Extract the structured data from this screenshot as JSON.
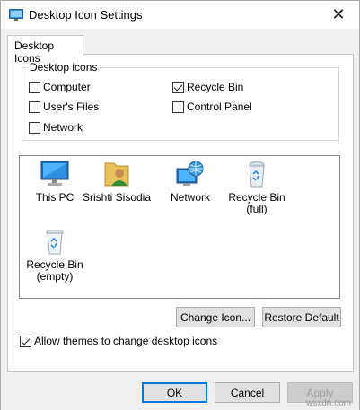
{
  "window": {
    "title": "Desktop Icon Settings",
    "close_glyph": "✕"
  },
  "tabs": [
    {
      "label": "Desktop Icons",
      "selected": true
    }
  ],
  "desktop_icons_group": {
    "title": "Desktop icons",
    "checkboxes": [
      {
        "label": "Computer",
        "checked": false
      },
      {
        "label": "Recycle Bin",
        "checked": true
      },
      {
        "label": "User's Files",
        "checked": false
      },
      {
        "label": "Control Panel",
        "checked": false
      },
      {
        "label": "Network",
        "checked": false
      }
    ]
  },
  "icon_list": [
    {
      "label": "This PC",
      "icon": "monitor-icon"
    },
    {
      "label": "Srishti Sisodia",
      "icon": "user-folder-icon"
    },
    {
      "label": "Network",
      "icon": "network-globe-icon"
    },
    {
      "label": "Recycle Bin\n(full)",
      "icon": "recycle-bin-full-icon"
    },
    {
      "label": "Recycle Bin\n(empty)",
      "icon": "recycle-bin-empty-icon"
    }
  ],
  "actions": {
    "change_icon": "Change Icon...",
    "restore_default": "Restore Default"
  },
  "allow_themes": {
    "label": "Allow themes to change desktop icons",
    "checked": true
  },
  "dialog_buttons": {
    "ok": "OK",
    "cancel": "Cancel",
    "apply": "Apply"
  },
  "watermark": "wsxdn.com"
}
